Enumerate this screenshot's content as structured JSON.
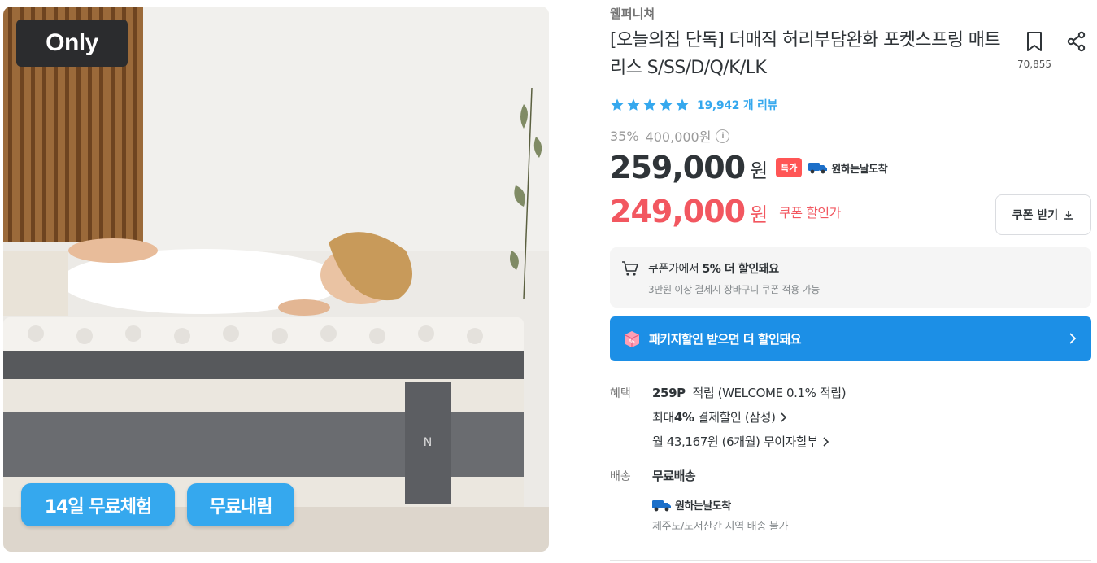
{
  "image": {
    "badge": "Only",
    "pill_trial": "14일 무료체험",
    "pill_delivery": "무료내림"
  },
  "product": {
    "brand": "웰퍼니쳐",
    "title": "[오늘의집 단독] 더매직 허리부담완화 포켓스프링 매트리스 S/SS/D/Q/K/LK",
    "bookmark_count": "70,855",
    "rating_stars": 5,
    "review_count": "19,942 개 리뷰"
  },
  "pricing": {
    "discount_rate": "35%",
    "original_price": "400,000원",
    "sale_price": "259,000",
    "won": "원",
    "special_badge": "특가",
    "delivery_badge": "원하는날도착",
    "coupon_price": "249,000",
    "coupon_won": "원",
    "coupon_label": "쿠폰 할인가",
    "coupon_button": "쿠폰 받기"
  },
  "cart_notice": {
    "main_prefix": "쿠폰가에서 ",
    "main_bold": "5% 더 할인돼요",
    "sub": "3만원 이상 결제시 장바구니 쿠폰 적용 가능"
  },
  "package_banner": {
    "label": "패키지할인 받으면 더 할인돼요"
  },
  "benefits": {
    "label": "혜택",
    "points_bold": "259P",
    "points_text": "적립 (WELCOME 0.1% 적립)",
    "card_prefix": "최대 ",
    "card_bold": "4%",
    "card_text": "결제할인 (삼성)",
    "installment": "월 43,167원 (6개월) 무이자할부"
  },
  "shipping": {
    "label": "배송",
    "main": "무료배송",
    "badge": "원하는날도착",
    "note": "제주도/도서산간 지역 배송 불가"
  },
  "colors": {
    "accent_blue": "#35a8ee",
    "banner_blue": "#1c8fe6",
    "coupon_red": "#f25760",
    "special_red": "#ff5555"
  }
}
